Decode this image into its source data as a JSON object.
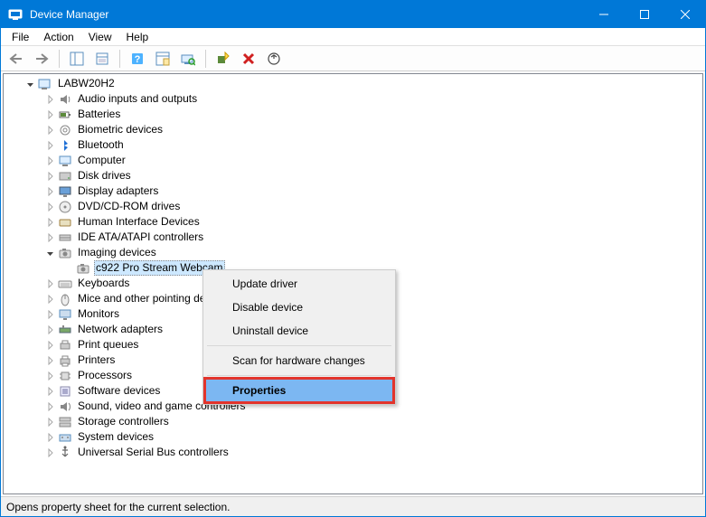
{
  "window": {
    "title": "Device Manager"
  },
  "menubar": {
    "file": "File",
    "action": "Action",
    "view": "View",
    "help": "Help"
  },
  "tree": {
    "root": "LABW20H2",
    "categories": [
      "Audio inputs and outputs",
      "Batteries",
      "Biometric devices",
      "Bluetooth",
      "Computer",
      "Disk drives",
      "Display adapters",
      "DVD/CD-ROM drives",
      "Human Interface Devices",
      "IDE ATA/ATAPI controllers",
      "Imaging devices",
      "Keyboards",
      "Mice and other pointing devices",
      "Monitors",
      "Network adapters",
      "Print queues",
      "Printers",
      "Processors",
      "Software devices",
      "Sound, video and game controllers",
      "Storage controllers",
      "System devices",
      "Universal Serial Bus controllers"
    ],
    "expanded_category_index": 10,
    "selected_device": "c922 Pro Stream Webcam"
  },
  "context_menu": {
    "items": [
      "Update driver",
      "Disable device",
      "Uninstall device",
      "Scan for hardware changes",
      "Properties"
    ],
    "highlighted_index": 4
  },
  "statusbar": {
    "text": "Opens property sheet for the current selection."
  }
}
